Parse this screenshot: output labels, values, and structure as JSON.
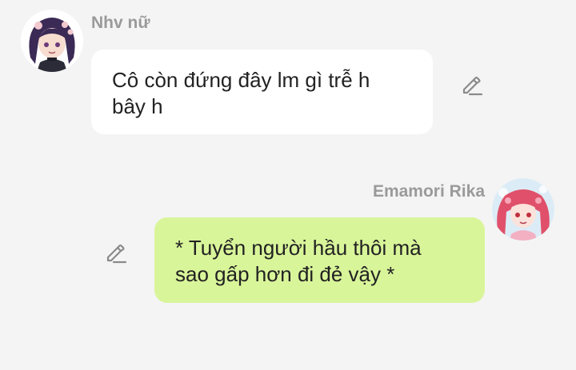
{
  "messages": [
    {
      "sender": "Nhv nữ",
      "side": "left",
      "lines": [
        "Cô còn đứng đây lm gì trễ h",
        "bây h"
      ],
      "avatar_icon": "avatar-purple-hair-girl",
      "edit_icon": "pencil-edit-icon",
      "bubble_color": "#ffffff"
    },
    {
      "sender": "Emamori Rika",
      "side": "right",
      "lines": [
        "* Tuyển người hầu thôi mà",
        "sao gấp hơn đi đẻ vậy *"
      ],
      "avatar_icon": "avatar-pink-hair-girl",
      "edit_icon": "pencil-edit-icon",
      "bubble_color": "#d9f59a"
    }
  ],
  "colors": {
    "background": "#f4f4f4",
    "sender_name": "#9a9a9a",
    "message_text": "#222222",
    "icon": "#8a8a8a"
  }
}
